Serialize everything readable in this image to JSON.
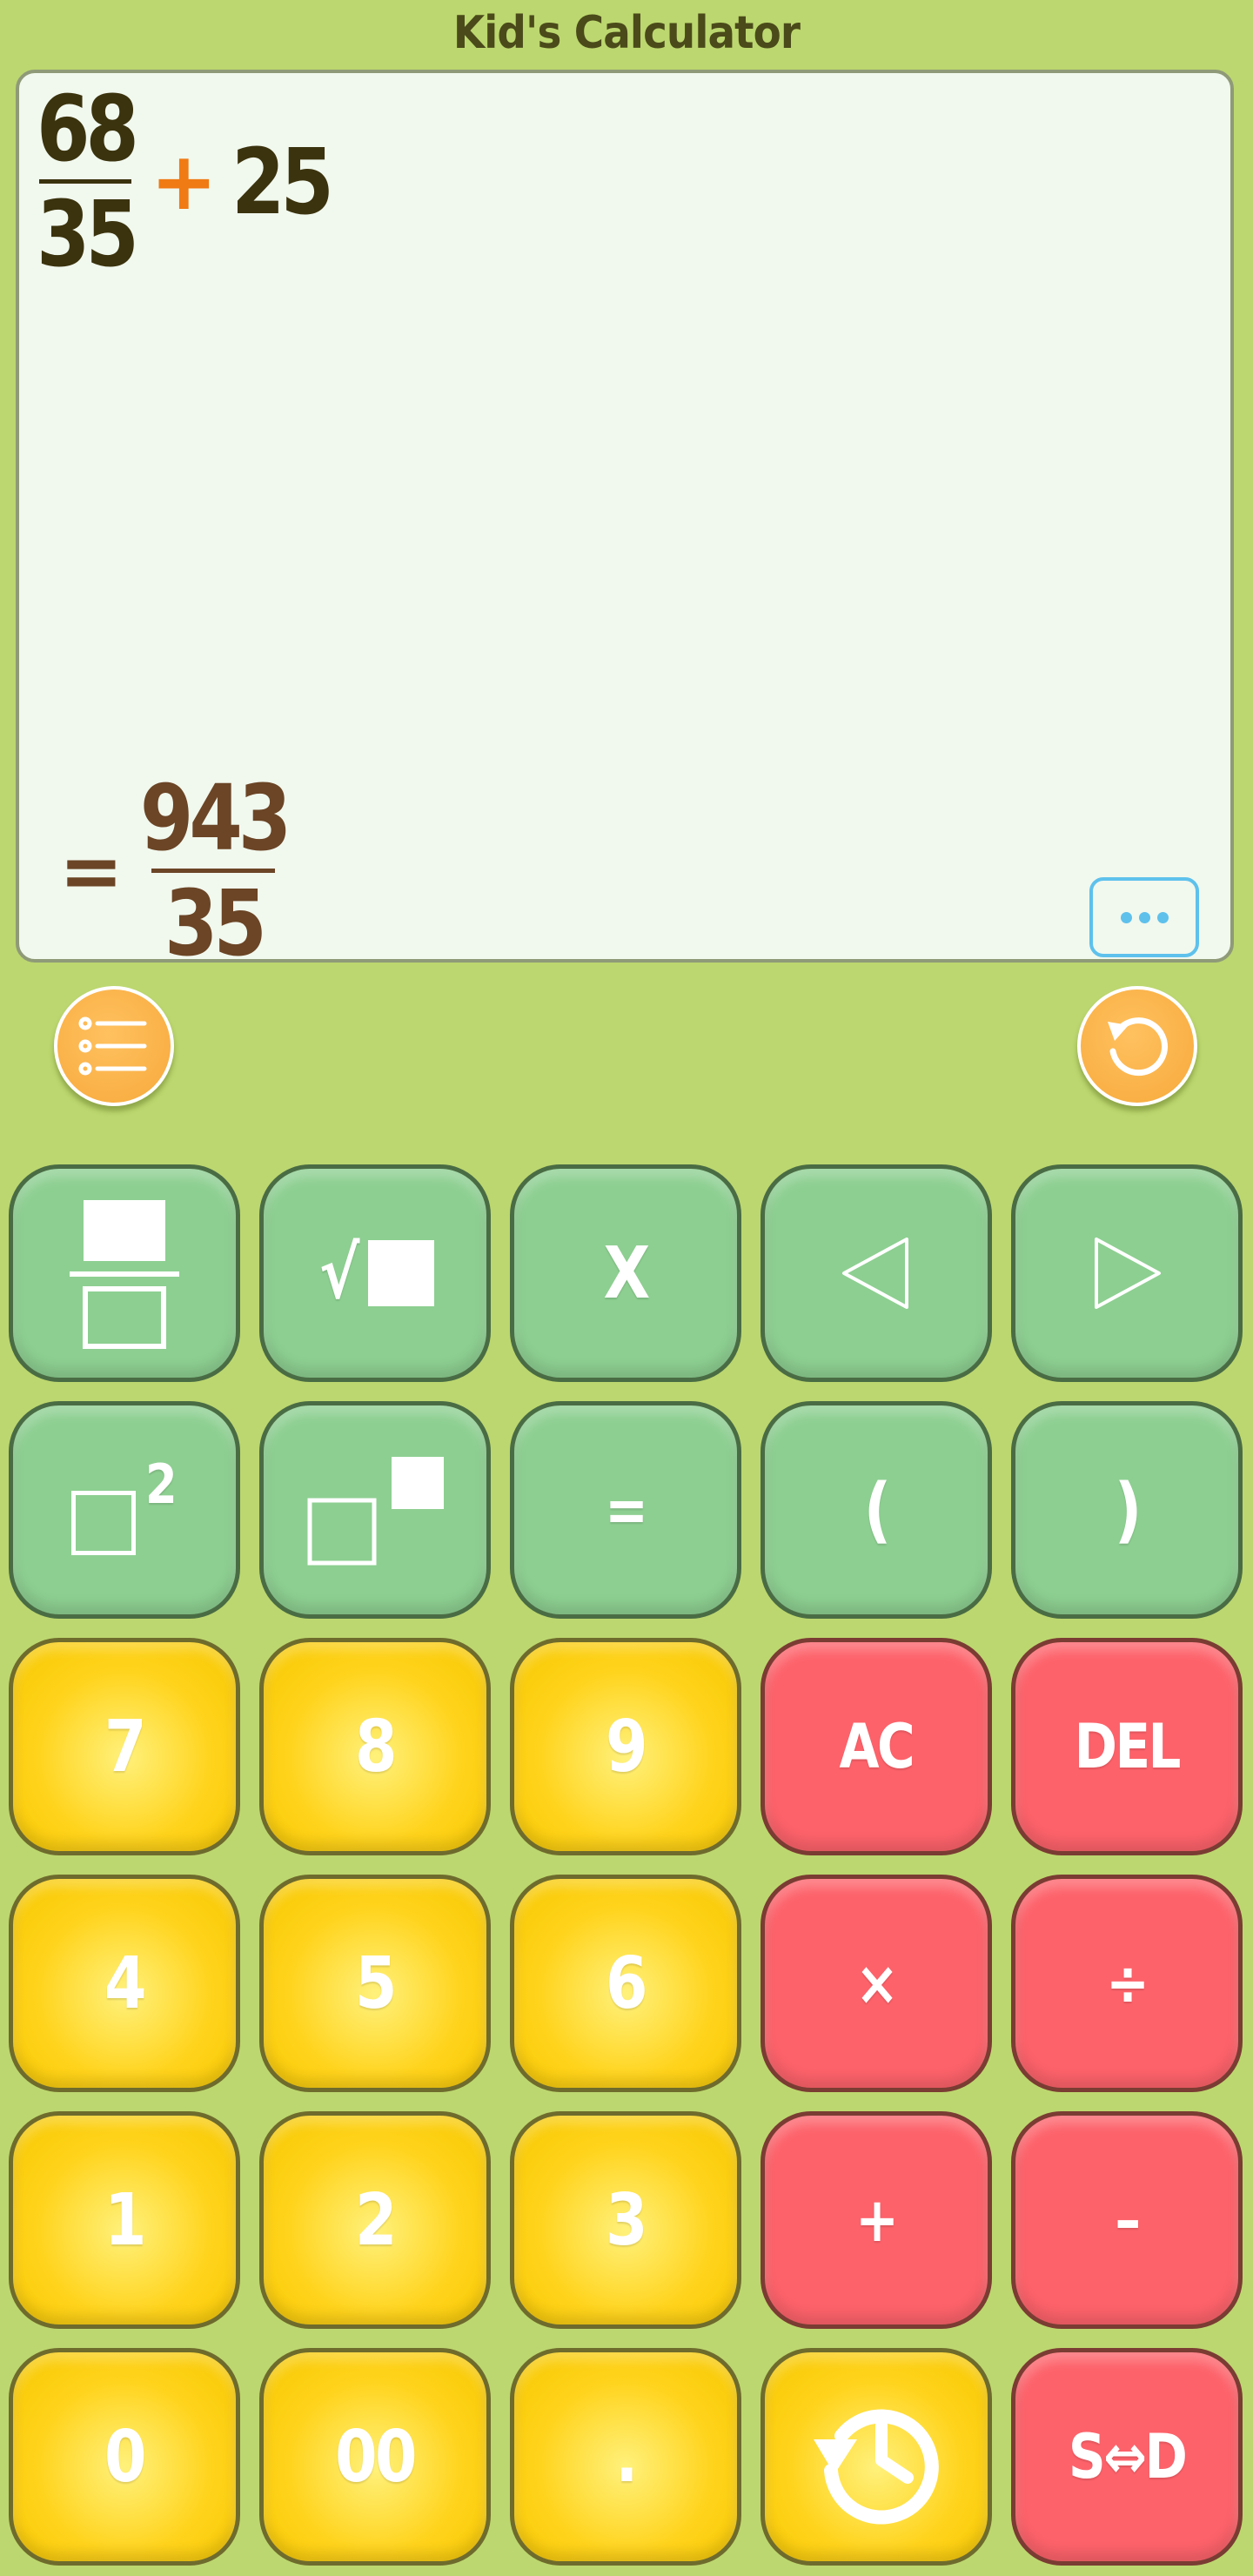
{
  "app": {
    "title": "Kid's Calculator"
  },
  "display": {
    "expression": {
      "numerator": "68",
      "denominator": "35",
      "operator": "+",
      "term": "25"
    },
    "result": {
      "equals": "=",
      "numerator": "943",
      "denominator": "35"
    }
  },
  "keys": {
    "fraction": "fraction-template-icon",
    "sqrt_symbol": "√",
    "variable": "X",
    "left": "◁",
    "right": "▷",
    "square_exp": "2",
    "equals": "=",
    "open_paren": "(",
    "close_paren": ")",
    "seven": "7",
    "eight": "8",
    "nine": "9",
    "ac": "AC",
    "del": "DEL",
    "four": "4",
    "five": "5",
    "six": "6",
    "multiply": "×",
    "divide": "÷",
    "one": "1",
    "two": "2",
    "three": "3",
    "plus": "+",
    "minus": "–",
    "zero": "0",
    "double_zero": "00",
    "dot": ".",
    "convert": "S⇔D"
  },
  "colors": {
    "background": "#bcd76f",
    "function_key": "#8dcf91",
    "number_key": "#ffd31b",
    "operator_key": "#fd626a",
    "accent_round": "#f7a93b",
    "display": "#f1f8ee"
  },
  "icons": {
    "menu": "list-icon",
    "reset": "refresh-icon",
    "more": "ellipsis-icon",
    "history": "history-clock-icon"
  }
}
